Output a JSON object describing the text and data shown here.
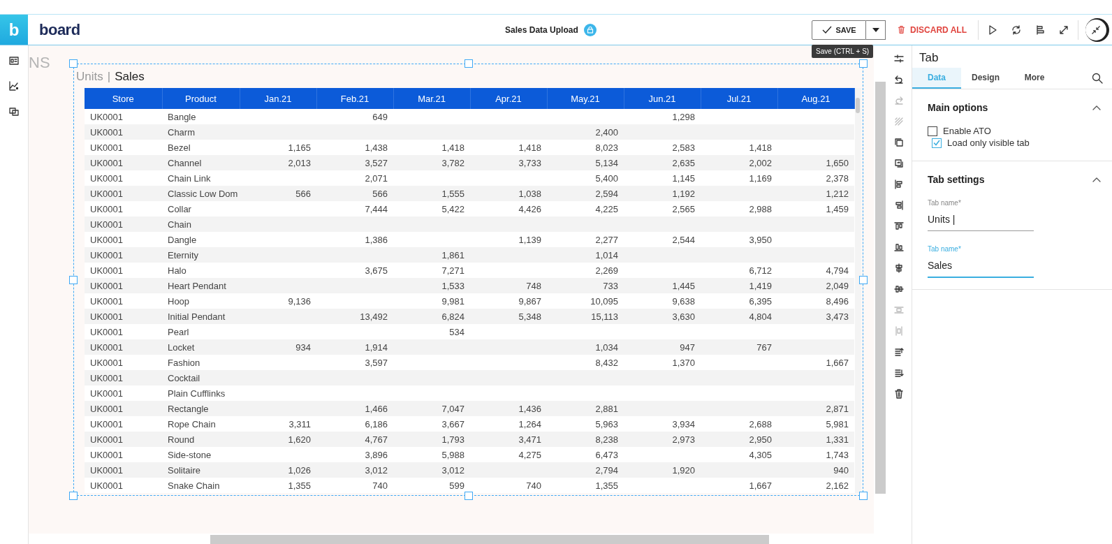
{
  "app": {
    "logo_mark": "b",
    "brand": "board"
  },
  "header": {
    "title": "Sales Data Upload",
    "save_label": "SAVE",
    "save_tooltip": "Save (CTRL + S)",
    "discard_label": "DISCARD ALL"
  },
  "canvas": {
    "faded_label": "NS"
  },
  "widget_tabs": {
    "separator": "|",
    "tabs": [
      {
        "label": "Units",
        "selected": false
      },
      {
        "label": "Sales",
        "selected": true
      }
    ]
  },
  "table": {
    "columns": [
      "Store",
      "Product",
      "Jan.21",
      "Feb.21",
      "Mar.21",
      "Apr.21",
      "May.21",
      "Jun.21",
      "Jul.21",
      "Aug.21"
    ],
    "rows": [
      [
        "UK0001",
        "Bangle",
        "",
        "649",
        "",
        "",
        "",
        "1,298",
        "",
        ""
      ],
      [
        "UK0001",
        "Charm",
        "",
        "",
        "",
        "",
        "2,400",
        "",
        "",
        ""
      ],
      [
        "UK0001",
        "Bezel",
        "1,165",
        "1,438",
        "1,418",
        "1,418",
        "8,023",
        "2,583",
        "1,418",
        ""
      ],
      [
        "UK0001",
        "Channel",
        "2,013",
        "3,527",
        "3,782",
        "3,733",
        "5,134",
        "2,635",
        "2,002",
        "1,650"
      ],
      [
        "UK0001",
        "Chain Link",
        "",
        "2,071",
        "",
        "",
        "5,400",
        "1,145",
        "1,169",
        "2,378"
      ],
      [
        "UK0001",
        "Classic Low Dom",
        "566",
        "566",
        "1,555",
        "1,038",
        "2,594",
        "1,192",
        "",
        "1,212"
      ],
      [
        "UK0001",
        "Collar",
        "",
        "7,444",
        "5,422",
        "4,426",
        "4,225",
        "2,565",
        "2,988",
        "1,459"
      ],
      [
        "UK0001",
        "Chain",
        "",
        "",
        "",
        "",
        "",
        "",
        "",
        ""
      ],
      [
        "UK0001",
        "Dangle",
        "",
        "1,386",
        "",
        "1,139",
        "2,277",
        "2,544",
        "3,950",
        ""
      ],
      [
        "UK0001",
        "Eternity",
        "",
        "",
        "1,861",
        "",
        "1,014",
        "",
        "",
        ""
      ],
      [
        "UK0001",
        "Halo",
        "",
        "3,675",
        "7,271",
        "",
        "2,269",
        "",
        "6,712",
        "4,794"
      ],
      [
        "UK0001",
        "Heart Pendant",
        "",
        "",
        "1,533",
        "748",
        "733",
        "1,445",
        "1,419",
        "2,049"
      ],
      [
        "UK0001",
        "Hoop",
        "9,136",
        "",
        "9,981",
        "9,867",
        "10,095",
        "9,638",
        "6,395",
        "8,496"
      ],
      [
        "UK0001",
        "Initial Pendant",
        "",
        "13,492",
        "6,824",
        "5,348",
        "15,113",
        "3,630",
        "4,804",
        "3,473"
      ],
      [
        "UK0001",
        "Pearl",
        "",
        "",
        "534",
        "",
        "",
        "",
        "",
        ""
      ],
      [
        "UK0001",
        "Locket",
        "934",
        "1,914",
        "",
        "",
        "1,034",
        "947",
        "767",
        ""
      ],
      [
        "UK0001",
        "Fashion",
        "",
        "3,597",
        "",
        "",
        "8,432",
        "1,370",
        "",
        "1,667"
      ],
      [
        "UK0001",
        "Cocktail",
        "",
        "",
        "",
        "",
        "",
        "",
        "",
        ""
      ],
      [
        "UK0001",
        "Plain Cufflinks",
        "",
        "",
        "",
        "",
        "",
        "",
        "",
        ""
      ],
      [
        "UK0001",
        "Rectangle",
        "",
        "1,466",
        "7,047",
        "1,436",
        "2,881",
        "",
        "",
        "2,871"
      ],
      [
        "UK0001",
        "Rope Chain",
        "3,311",
        "6,186",
        "3,667",
        "1,264",
        "5,963",
        "3,934",
        "2,688",
        "5,981"
      ],
      [
        "UK0001",
        "Round",
        "1,620",
        "4,767",
        "1,793",
        "3,471",
        "8,238",
        "2,973",
        "2,950",
        "1,331"
      ],
      [
        "UK0001",
        "Side-stone",
        "",
        "3,896",
        "5,988",
        "4,275",
        "6,473",
        "",
        "4,305",
        "1,743"
      ],
      [
        "UK0001",
        "Solitaire",
        "1,026",
        "3,012",
        "3,012",
        "",
        "2,794",
        "1,920",
        "",
        "940"
      ],
      [
        "UK0001",
        "Snake Chain",
        "1,355",
        "740",
        "599",
        "740",
        "1,355",
        "",
        "1,667",
        "2,162"
      ]
    ]
  },
  "toolbar": [
    {
      "kind": "sliders",
      "disabled": false
    },
    {
      "kind": "undo",
      "disabled": false
    },
    {
      "kind": "redo",
      "disabled": true
    },
    {
      "kind": "hatch",
      "disabled": true
    },
    {
      "kind": "copy",
      "disabled": false
    },
    {
      "kind": "paste",
      "disabled": false
    },
    {
      "kind": "align-left",
      "disabled": false
    },
    {
      "kind": "align-right",
      "disabled": false
    },
    {
      "kind": "align-top",
      "disabled": false
    },
    {
      "kind": "align-bottom",
      "disabled": false
    },
    {
      "kind": "center-h",
      "disabled": false
    },
    {
      "kind": "center-v",
      "disabled": false
    },
    {
      "kind": "distribute-h",
      "disabled": true
    },
    {
      "kind": "distribute-v",
      "disabled": true
    },
    {
      "kind": "bring-forward",
      "disabled": false
    },
    {
      "kind": "send-backward",
      "disabled": false
    },
    {
      "kind": "delete",
      "disabled": false
    }
  ],
  "panel": {
    "title": "Tab",
    "tabs": [
      {
        "label": "Data",
        "selected": true
      },
      {
        "label": "Design",
        "selected": false
      },
      {
        "label": "More",
        "selected": false
      }
    ],
    "sections": [
      {
        "title": "Main options",
        "expanded": true,
        "kind": "checkboxes",
        "items": [
          {
            "label": "Enable ATO",
            "checked": false
          },
          {
            "label": "Load only visible tab",
            "checked": true
          }
        ]
      },
      {
        "title": "Tab settings",
        "expanded": true,
        "kind": "fields",
        "items": [
          {
            "label": "Tab name*",
            "value": "Units |",
            "focused": false
          },
          {
            "label": "Tab name*",
            "value": "Sales",
            "focused": true
          }
        ]
      }
    ]
  }
}
